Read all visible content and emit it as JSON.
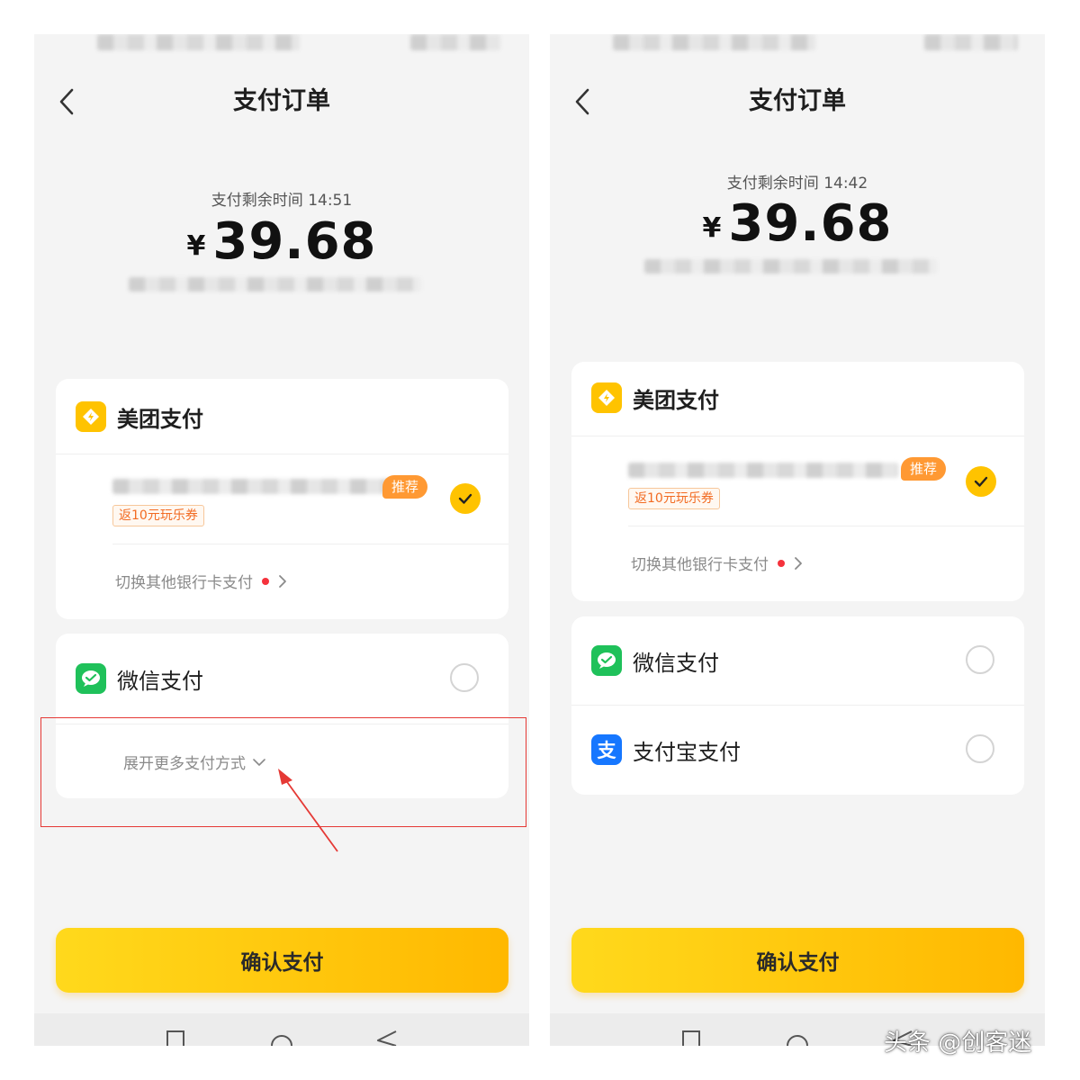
{
  "screens": [
    {
      "title": "支付订单",
      "timer": "支付剩余时间 14:51",
      "currency": "¥",
      "amount": "39.68",
      "meituan": {
        "name": "美团支付",
        "recommend_tag": "推荐",
        "coupon_tag": "返10元玩乐券",
        "switch_card": "切换其他银行卡支付"
      },
      "wechat": {
        "name": "微信支付"
      },
      "expand_more": "展开更多支付方式",
      "confirm": "确认支付"
    },
    {
      "title": "支付订单",
      "timer": "支付剩余时间 14:42",
      "currency": "¥",
      "amount": "39.68",
      "meituan": {
        "name": "美团支付",
        "recommend_tag": "推荐",
        "coupon_tag": "返10元玩乐券",
        "switch_card": "切换其他银行卡支付"
      },
      "wechat": {
        "name": "微信支付"
      },
      "alipay": {
        "name": "支付宝支付",
        "icon_glyph": "支"
      },
      "confirm": "确认支付"
    }
  ],
  "watermark": "头条 @创客迷",
  "colors": {
    "brand_yellow": "#ffc300",
    "recommend_orange": "#ff9933",
    "coupon_orange": "#f26b22",
    "wechat_green": "#1fc15a",
    "alipay_blue": "#1677ff",
    "red_dot": "#f5323c",
    "annotation_red": "#e53935"
  },
  "icons": [
    "back-arrow-icon",
    "meituan-pay-icon",
    "checkmark-icon",
    "chevron-right-icon",
    "wechat-pay-icon",
    "alipay-icon",
    "chevron-down-icon",
    "nav-square-icon",
    "nav-circle-icon",
    "nav-triangle-icon"
  ]
}
